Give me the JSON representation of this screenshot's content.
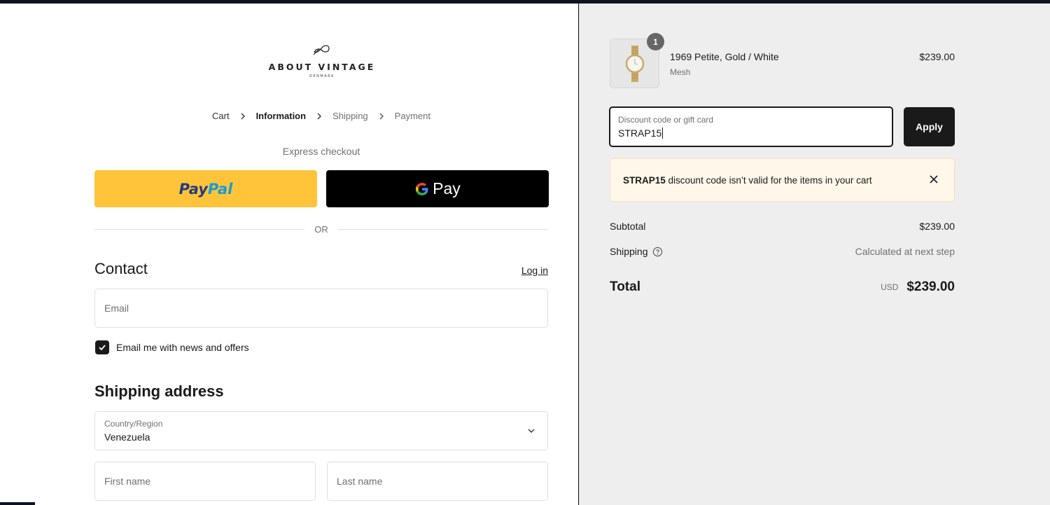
{
  "brand": {
    "name": "ABOUT VINTAGE",
    "sub": "DENMARK"
  },
  "breadcrumb": [
    {
      "label": "Cart",
      "state": "link"
    },
    {
      "label": "Information",
      "state": "active"
    },
    {
      "label": "Shipping",
      "state": "disabled"
    },
    {
      "label": "Payment",
      "state": "disabled"
    }
  ],
  "express": {
    "label": "Express checkout",
    "paypal_pay": "Pay",
    "paypal_pal": "Pal",
    "gpay_label": "Pay",
    "or_label": "OR"
  },
  "contact": {
    "title": "Contact",
    "login_label": "Log in",
    "email_placeholder": "Email",
    "news_checkbox_label": "Email me with news and offers",
    "news_checked": true
  },
  "shipping_address": {
    "title": "Shipping address",
    "country_label": "Country/Region",
    "country_value": "Venezuela",
    "first_name_placeholder": "First name",
    "last_name_placeholder": "Last name"
  },
  "cart": {
    "items": [
      {
        "name": "1969 Petite, Gold / White",
        "variant": "Mesh",
        "price": "$239.00",
        "quantity": "1"
      }
    ]
  },
  "discount": {
    "label": "Discount code or gift card",
    "value": "STRAP15",
    "apply_label": "Apply",
    "error_code": "STRAP15",
    "error_message": " discount code isn’t valid for the items in your cart"
  },
  "summary": {
    "subtotal_label": "Subtotal",
    "subtotal_value": "$239.00",
    "shipping_label": "Shipping",
    "shipping_value": "Calculated at next step",
    "total_label": "Total",
    "total_currency": "USD",
    "total_value": "$239.00"
  },
  "colors": {
    "paypal_yellow": "#ffc439",
    "paypal_dark_blue": "#253b80",
    "paypal_light_blue": "#179bd7",
    "primary_button": "#1a1a1a",
    "alert_background": "#fff7ea",
    "sidebar_background": "#eeeeee"
  },
  "icons": {
    "breadcrumb_separator": "chevron-right-icon",
    "country_select": "chevron-down-icon",
    "alert_close": "close-icon",
    "shipping_help": "question-circle-icon",
    "checkbox": "checkmark-icon"
  }
}
